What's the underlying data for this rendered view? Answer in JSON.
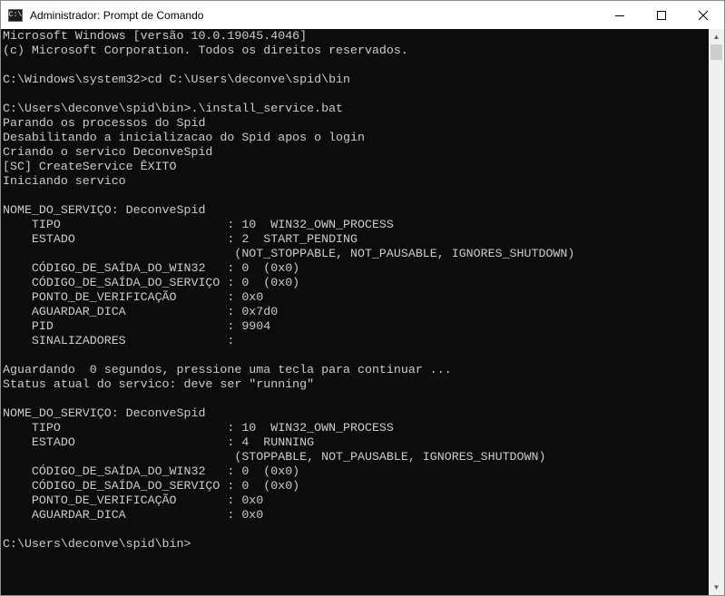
{
  "window": {
    "title": "Administrador: Prompt de Comando",
    "icon_label": "C:\\"
  },
  "icons": {
    "app": "cmd-icon",
    "minimize": "minimize-icon",
    "maximize": "maximize-icon",
    "close": "close-icon",
    "scroll_up": "scroll-up-arrow-icon",
    "scroll_down": "scroll-down-arrow-icon"
  },
  "console": {
    "lines": [
      "Microsoft Windows [versão 10.0.19045.4046]",
      "(c) Microsoft Corporation. Todos os direitos reservados.",
      "",
      "C:\\Windows\\system32>cd C:\\Users\\deconve\\spid\\bin",
      "",
      "C:\\Users\\deconve\\spid\\bin>.\\install_service.bat",
      "Parando os processos do Spid",
      "Desabilitando a inicializacao do Spid apos o login",
      "Criando o servico DeconveSpid",
      "[SC] CreateService ÊXITO",
      "Iniciando servico",
      "",
      "NOME_DO_SERVIÇO: DeconveSpid",
      "    TIPO                       : 10  WIN32_OWN_PROCESS",
      "    ESTADO                     : 2  START_PENDING",
      "                                (NOT_STOPPABLE, NOT_PAUSABLE, IGNORES_SHUTDOWN)",
      "    CÓDIGO_DE_SAÍDA_DO_WIN32   : 0  (0x0)",
      "    CÓDIGO_DE_SAÍDA_DO_SERVIÇO : 0  (0x0)",
      "    PONTO_DE_VERIFICAÇÃO       : 0x0",
      "    AGUARDAR_DICA              : 0x7d0",
      "    PID                        : 9904",
      "    SINALIZADORES              :",
      "",
      "Aguardando  0 segundos, pressione uma tecla para continuar ...",
      "Status atual do servico: deve ser \"running\"",
      "",
      "NOME_DO_SERVIÇO: DeconveSpid",
      "    TIPO                       : 10  WIN32_OWN_PROCESS",
      "    ESTADO                     : 4  RUNNING",
      "                                (STOPPABLE, NOT_PAUSABLE, IGNORES_SHUTDOWN)",
      "    CÓDIGO_DE_SAÍDA_DO_WIN32   : 0  (0x0)",
      "    CÓDIGO_DE_SAÍDA_DO_SERVIÇO : 0  (0x0)",
      "    PONTO_DE_VERIFICAÇÃO       : 0x0",
      "    AGUARDAR_DICA              : 0x0",
      "",
      "C:\\Users\\deconve\\spid\\bin>"
    ]
  }
}
